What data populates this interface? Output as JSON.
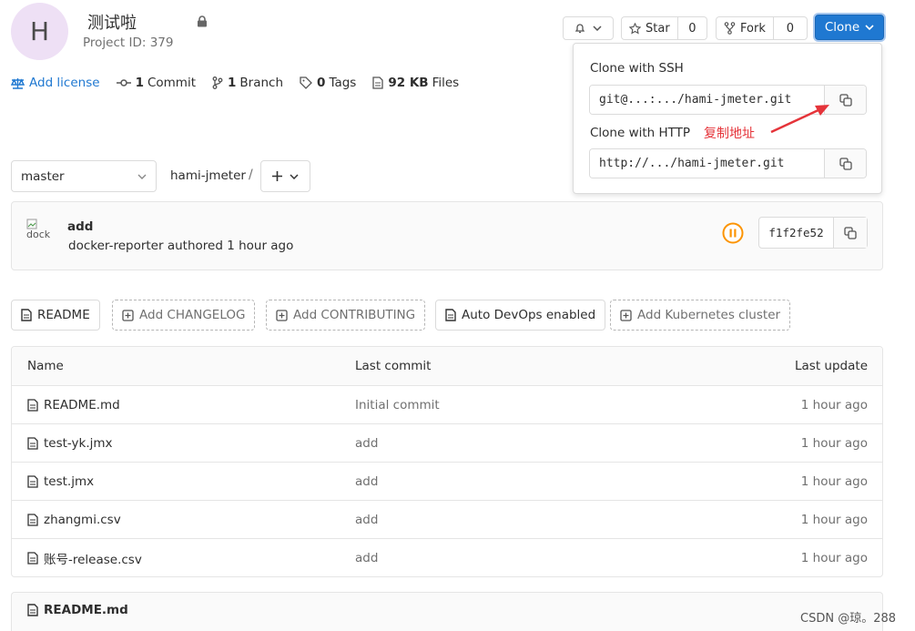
{
  "project": {
    "avatar_letter": "H",
    "title": "测试啦",
    "id_text": "Project ID: 379"
  },
  "stats": {
    "license": "Add license",
    "commits_count": "1",
    "commits_label": "Commit",
    "branches_count": "1",
    "branches_label": "Branch",
    "tags_count": "0",
    "tags_label": "Tags",
    "files_size": "92 KB",
    "files_label": "Files"
  },
  "actions": {
    "star_label": "Star",
    "star_count": "0",
    "fork_label": "Fork",
    "fork_count": "0",
    "clone_label": "Clone"
  },
  "clone_dropdown": {
    "ssh_label": "Clone with SSH",
    "ssh_value": "git@...:.../hami-jmeter.git",
    "http_label": "Clone with HTTP",
    "http_value": "http://.../hami-jmeter.git"
  },
  "annotation": "复制地址",
  "branch": {
    "selected": "master",
    "breadcrumb": "hami-jmeter",
    "separator": "/"
  },
  "commit": {
    "avatar_alt": "dock",
    "title": "add",
    "meta": "docker-reporter authored 1 hour ago",
    "sha": "f1f2fe52"
  },
  "quick_links": [
    {
      "label": "README"
    },
    {
      "label": "Add CHANGELOG"
    },
    {
      "label": "Add CONTRIBUTING"
    },
    {
      "label": "Auto DevOps enabled"
    },
    {
      "label": "Add Kubernetes cluster"
    }
  ],
  "table": {
    "headers": {
      "name": "Name",
      "last_commit": "Last commit",
      "last_update": "Last update"
    },
    "rows": [
      {
        "name": "README.md",
        "commit": "Initial commit",
        "update": "1 hour ago"
      },
      {
        "name": "test-yk.jmx",
        "commit": "add",
        "update": "1 hour ago"
      },
      {
        "name": "test.jmx",
        "commit": "add",
        "update": "1 hour ago"
      },
      {
        "name": "zhangmi.csv",
        "commit": "add",
        "update": "1 hour ago"
      },
      {
        "name": "账号-release.csv",
        "commit": "add",
        "update": "1 hour ago"
      }
    ]
  },
  "readme_title": "README.md",
  "watermark": "CSDN @琼。288",
  "colors": {
    "accent": "#1f78d1",
    "annotation_red": "#e5343a",
    "pipeline_orange": "#fc9403"
  }
}
